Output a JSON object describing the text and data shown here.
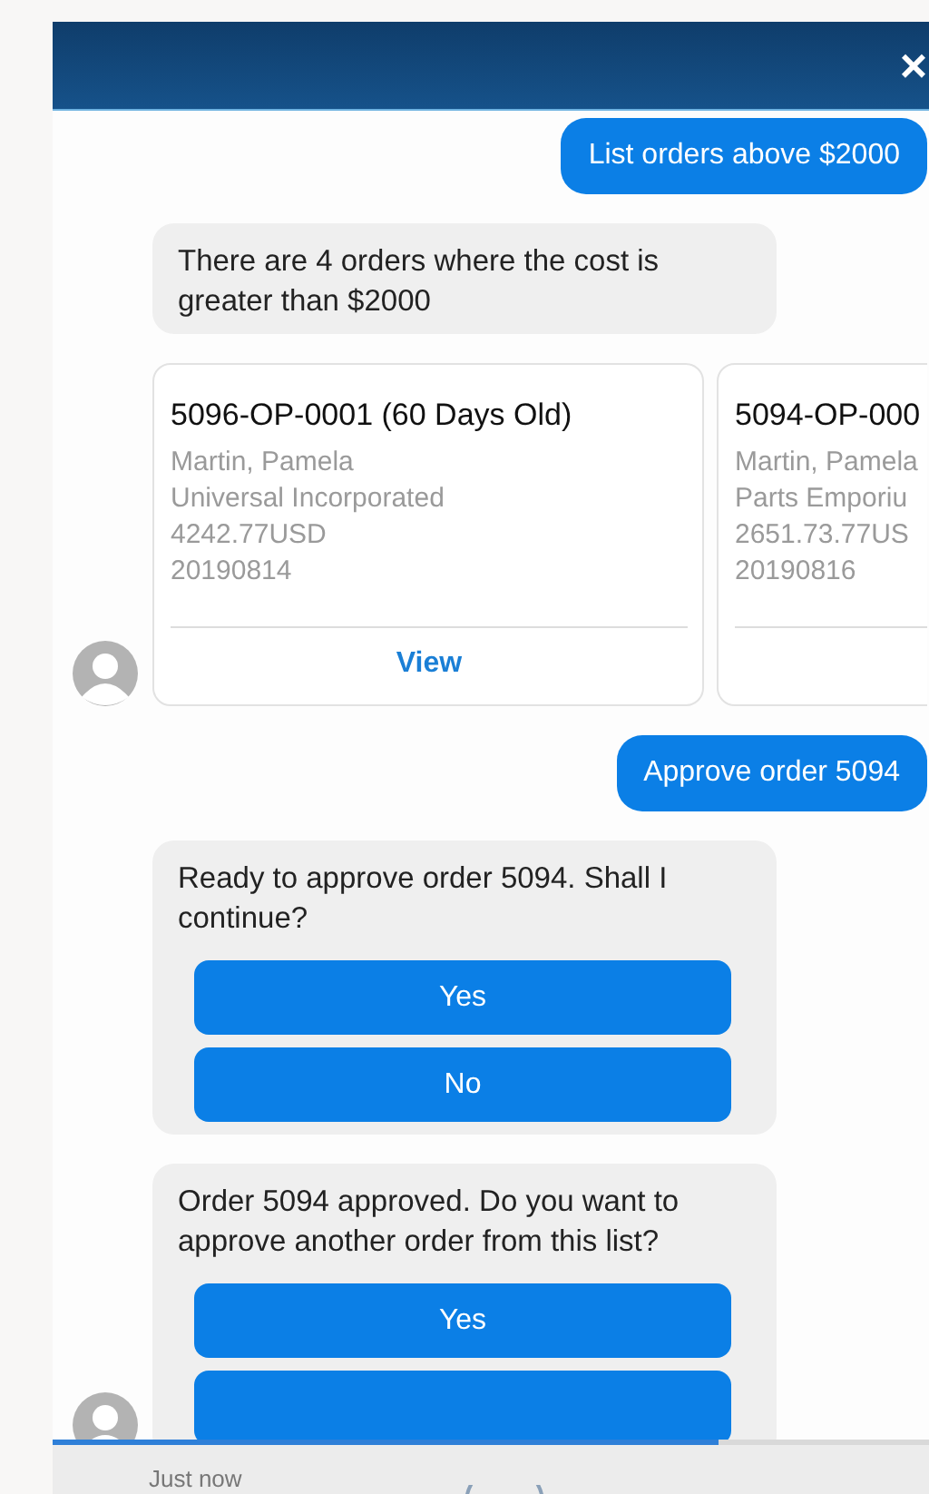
{
  "header": {
    "close": "×"
  },
  "messages": [
    {
      "kind": "user",
      "text": "List orders above $2000"
    },
    {
      "kind": "bot",
      "text": "There are 4 orders where the cost is greater than $2000",
      "avatar": false
    },
    {
      "kind": "cards",
      "avatar": true,
      "cards": [
        {
          "title": "5096-OP-0001 (60 Days Old)",
          "lines": [
            "Martin, Pamela",
            "Universal Incorporated",
            "4242.77USD",
            "20190814"
          ],
          "action": "View"
        },
        {
          "title": "5094-OP-000",
          "lines": [
            "Martin, Pamela",
            "Parts Emporiu",
            "2651.73.77US",
            "20190816"
          ]
        }
      ]
    },
    {
      "kind": "user",
      "text": "Approve order 5094"
    },
    {
      "kind": "bot",
      "text": "Ready to approve order 5094. Shall I continue?",
      "avatar": false,
      "buttons": [
        {
          "kind": "text",
          "label": "Yes"
        },
        {
          "kind": "text",
          "label": "No"
        }
      ]
    },
    {
      "kind": "bot",
      "text": "Order 5094 approved. Do you want to approve another order from this list?",
      "avatar": true,
      "buttons": [
        {
          "kind": "text",
          "label": "Yes"
        },
        {
          "kind": "blank"
        }
      ]
    }
  ],
  "progress": {
    "level": 0.76
  },
  "footer": {
    "time": "Just now"
  }
}
